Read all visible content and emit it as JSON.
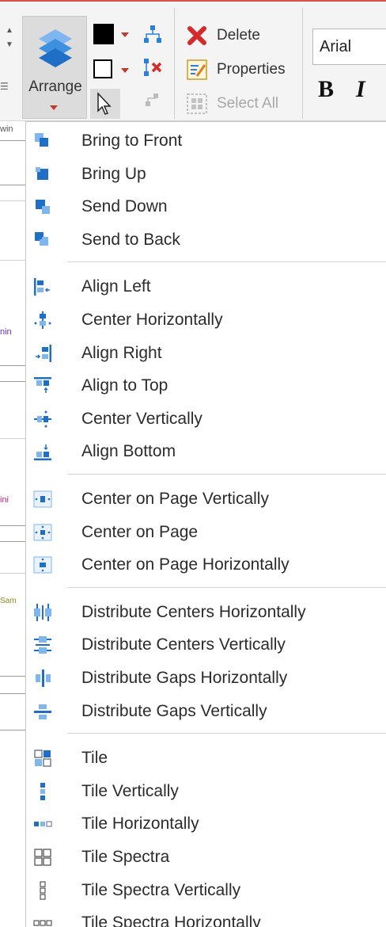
{
  "ribbon": {
    "arrange_label": "Arrange",
    "delete_label": "Delete",
    "properties_label": "Properties",
    "select_all_label": "Select All",
    "font_name": "Arial",
    "bold_label": "B",
    "italic_label": "I"
  },
  "canvas_fragments": [
    "win",
    "nin",
    "ini",
    "Sam"
  ],
  "menu": {
    "groups": [
      {
        "items": [
          {
            "label": "Bring to Front",
            "icon": "bring-to-front-icon"
          },
          {
            "label": "Bring Up",
            "icon": "bring-up-icon"
          },
          {
            "label": "Send Down",
            "icon": "send-down-icon"
          },
          {
            "label": "Send to Back",
            "icon": "send-to-back-icon"
          }
        ]
      },
      {
        "items": [
          {
            "label": "Align Left",
            "icon": "align-left-icon"
          },
          {
            "label": "Center Horizontally",
            "icon": "center-horizontally-icon"
          },
          {
            "label": "Align Right",
            "icon": "align-right-icon"
          },
          {
            "label": "Align to Top",
            "icon": "align-top-icon"
          },
          {
            "label": "Center Vertically",
            "icon": "center-vertically-icon"
          },
          {
            "label": "Align Bottom",
            "icon": "align-bottom-icon"
          }
        ]
      },
      {
        "items": [
          {
            "label": "Center on Page Vertically",
            "icon": "center-page-vertically-icon"
          },
          {
            "label": "Center on Page",
            "icon": "center-page-icon"
          },
          {
            "label": "Center on Page Horizontally",
            "icon": "center-page-horizontally-icon"
          }
        ]
      },
      {
        "items": [
          {
            "label": "Distribute Centers Horizontally",
            "icon": "distribute-centers-horizontally-icon"
          },
          {
            "label": "Distribute Centers Vertically",
            "icon": "distribute-centers-vertically-icon"
          },
          {
            "label": "Distribute Gaps Horizontally",
            "icon": "distribute-gaps-horizontally-icon"
          },
          {
            "label": "Distribute Gaps Vertically",
            "icon": "distribute-gaps-vertically-icon"
          }
        ]
      },
      {
        "items": [
          {
            "label": "Tile",
            "icon": "tile-icon"
          },
          {
            "label": "Tile Vertically",
            "icon": "tile-vertically-icon"
          },
          {
            "label": "Tile Horizontally",
            "icon": "tile-horizontally-icon"
          },
          {
            "label": "Tile Spectra",
            "icon": "tile-spectra-icon"
          },
          {
            "label": "Tile Spectra Vertically",
            "icon": "tile-spectra-vertically-icon"
          },
          {
            "label": "Tile Spectra Horizontally",
            "icon": "tile-spectra-horizontally-icon"
          }
        ]
      }
    ]
  },
  "colors": {
    "accent_blue": "#2f7fd6",
    "light_blue": "#7fb6ef",
    "delete_red": "#d42a2a",
    "caret_red": "#c0392b",
    "canvas_purple": "#6a2fb3",
    "canvas_magenta": "#c0287a",
    "canvas_olive": "#8a8a1e"
  }
}
